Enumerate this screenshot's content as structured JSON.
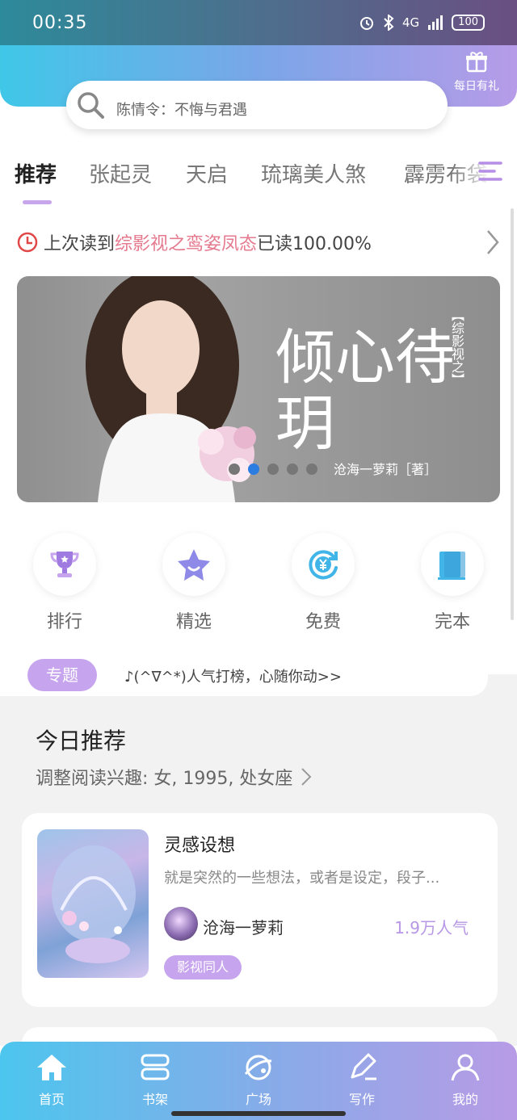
{
  "status_bar": {
    "time": "00:35",
    "network": "4G",
    "battery": "100"
  },
  "header": {
    "gift_label": "每日有礼"
  },
  "search": {
    "text": "陈情令：不悔与君遇"
  },
  "tabs": [
    {
      "label": "推荐",
      "active": true
    },
    {
      "label": "张起灵"
    },
    {
      "label": "天启"
    },
    {
      "label": "琉璃美人煞"
    },
    {
      "label": "霹雳布袋戏"
    }
  ],
  "last_read": {
    "prefix": "上次读到",
    "book": "综影视之鸾姿凤态",
    "suffix": "已读100.00%"
  },
  "banner": {
    "title": "倾心待玥",
    "subtitle": "【综影视之】",
    "author": "沧海一萝莉［著］",
    "slide_count": 5,
    "active_slide": 1
  },
  "quick_links": [
    {
      "label": "排行",
      "icon": "trophy-icon"
    },
    {
      "label": "精选",
      "icon": "star-icon"
    },
    {
      "label": "免费",
      "icon": "yen-refresh-icon"
    },
    {
      "label": "完本",
      "icon": "book-icon"
    }
  ],
  "topic": {
    "tag": "专题",
    "text": "♪(^∇^*)人气打榜，心随你动>>"
  },
  "today": {
    "title": "今日推荐",
    "interest": "调整阅读兴趣: 女, 1995, 处女座"
  },
  "recommend_card": {
    "title": "灵感设想",
    "desc": "就是突然的一些想法，或者是设定，段子...",
    "author": "沧海一萝莉",
    "popularity": "1.9万人气",
    "genre": "影视同人"
  },
  "bottom_nav": [
    {
      "label": "首页",
      "icon": "home-icon"
    },
    {
      "label": "书架",
      "icon": "bookshelf-icon"
    },
    {
      "label": "广场",
      "icon": "planet-icon"
    },
    {
      "label": "写作",
      "icon": "pen-icon"
    },
    {
      "label": "我的",
      "icon": "user-icon"
    }
  ],
  "colors": {
    "accent": "#c7a4ee",
    "highlight": "#e57a8f",
    "active_dot": "#2b7de1"
  }
}
